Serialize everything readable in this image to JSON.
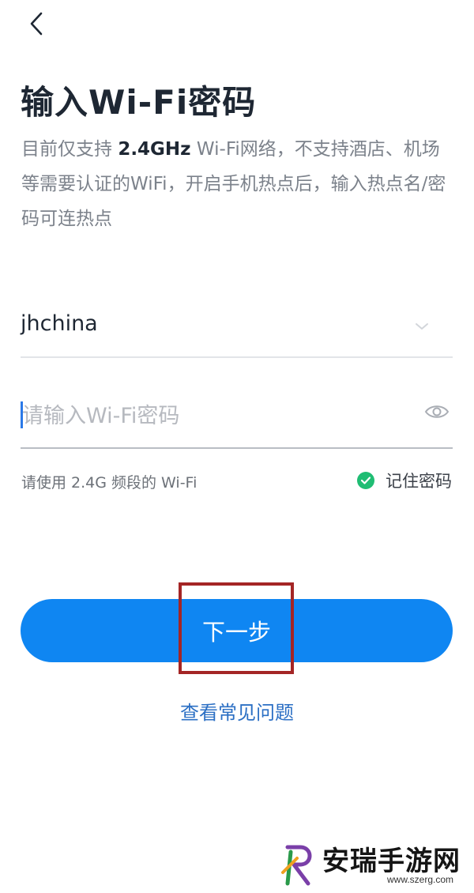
{
  "header": {
    "back_icon": "chevron-left-icon"
  },
  "page": {
    "title": "输入Wi-Fi密码",
    "description_prefix": "目前仅支持 ",
    "description_bold": "2.4GHz",
    "description_suffix": " Wi-Fi网络，不支持酒店、机场等需要认证的WiFi，开启手机热点后，输入热点名/密码可连热点"
  },
  "form": {
    "ssid_value": "jhchina",
    "password_placeholder": "请输入Wi-Fi密码",
    "password_value": "",
    "band_hint": "请使用 2.4G 频段的 Wi-Fi",
    "remember_label": "记住密码",
    "remember_checked": true
  },
  "actions": {
    "next_label": "下一步",
    "faq_label": "查看常见问题"
  },
  "watermark": {
    "title": "安瑞手游网",
    "url": "www.szerg.com"
  },
  "colors": {
    "accent": "#0f86f2",
    "check_green": "#1fbd73",
    "highlight_red": "#a42525",
    "link_blue": "#2b6fc4"
  }
}
